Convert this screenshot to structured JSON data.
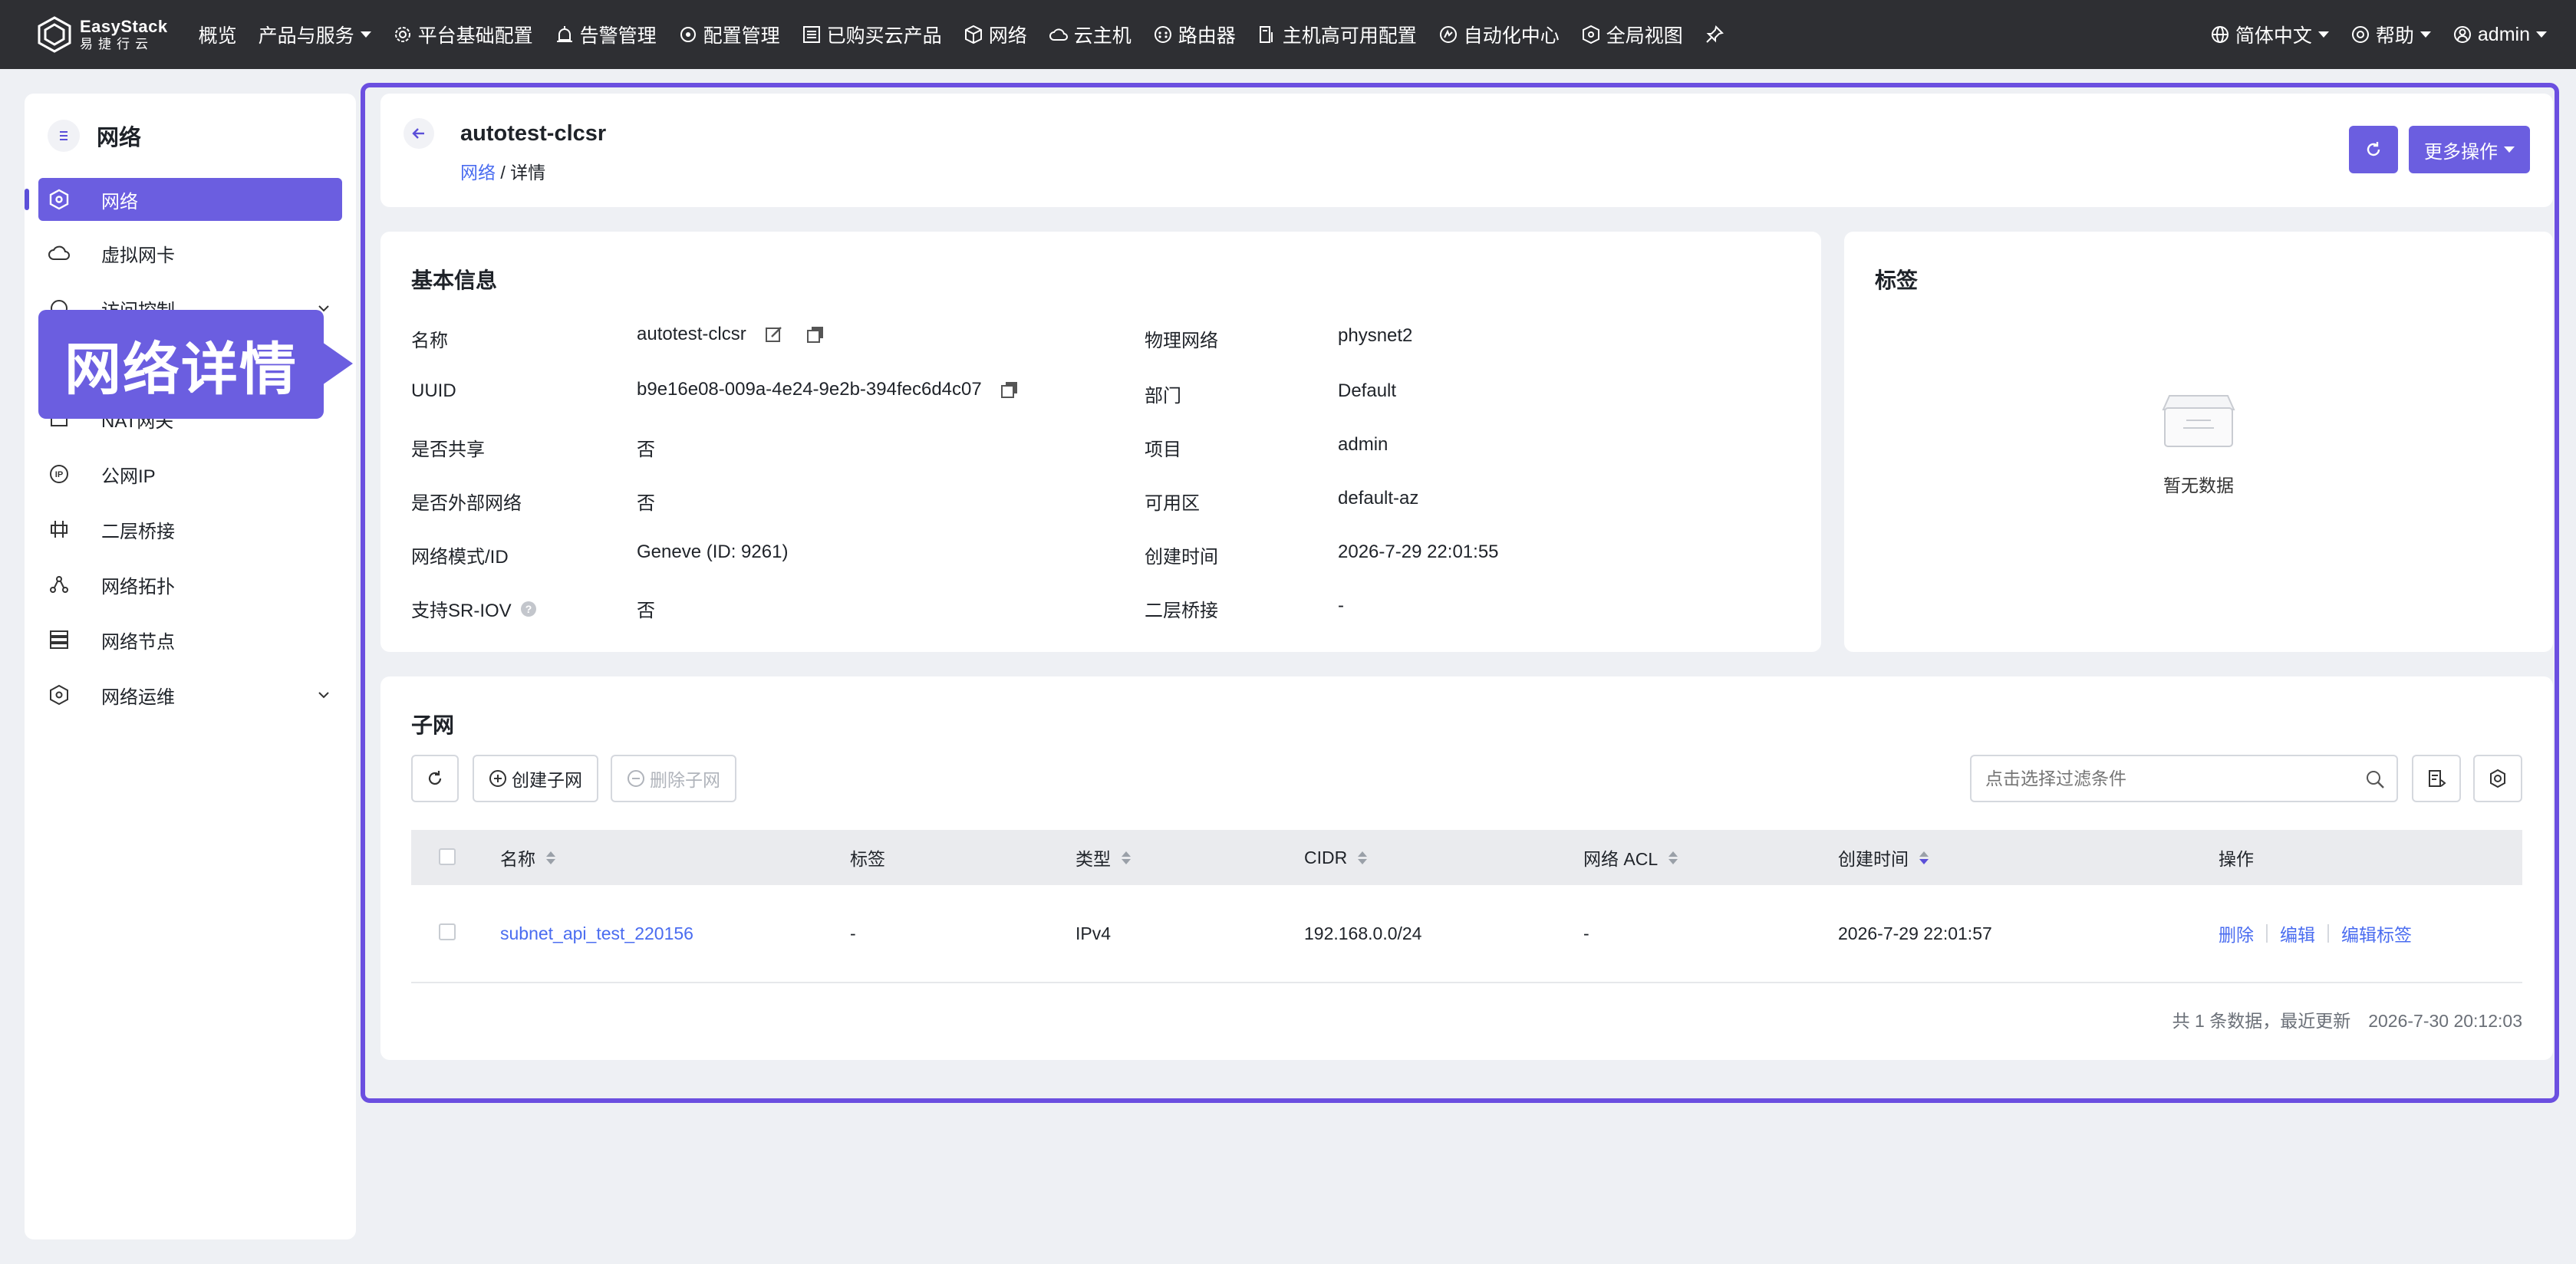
{
  "brand": {
    "en": "EasyStack",
    "cn": "易捷行云"
  },
  "nav": {
    "items": [
      "概览",
      "产品与服务",
      "平台基础配置",
      "告警管理",
      "配置管理",
      "已购买云产品",
      "网络",
      "云主机",
      "路由器",
      "主机高可用配置",
      "自动化中心",
      "全局视图"
    ],
    "language": "简体中文",
    "help": "帮助",
    "user": "admin"
  },
  "sidebar": {
    "title": "网络",
    "items": [
      {
        "label": "网络",
        "active": true
      },
      {
        "label": "虚拟网卡"
      },
      {
        "label": "访问控制"
      },
      {
        "label": "NAT网关"
      },
      {
        "label": "公网IP"
      },
      {
        "label": "二层桥接"
      },
      {
        "label": "网络拓扑"
      },
      {
        "label": "网络节点"
      },
      {
        "label": "网络运维"
      }
    ]
  },
  "callout": {
    "text": "网络详情"
  },
  "header": {
    "title": "autotest-clcsr",
    "breadcrumb_link": "网络",
    "breadcrumb_sep": "/",
    "breadcrumb_current": "详情",
    "more_label": "更多操作"
  },
  "basic": {
    "title": "基本信息",
    "left": [
      {
        "label": "名称",
        "value": "autotest-clcsr"
      },
      {
        "label": "UUID",
        "value": "b9e16e08-009a-4e24-9e2b-394fec6d4c07"
      },
      {
        "label": "是否共享",
        "value": "否"
      },
      {
        "label": "是否外部网络",
        "value": "否"
      },
      {
        "label": "网络模式/ID",
        "value": "Geneve (ID: 9261)"
      },
      {
        "label": "支持SR-IOV",
        "value": "否"
      }
    ],
    "right": [
      {
        "label": "物理网络",
        "value": "physnet2"
      },
      {
        "label": "部门",
        "value": "Default"
      },
      {
        "label": "项目",
        "value": "admin"
      },
      {
        "label": "可用区",
        "value": "default-az"
      },
      {
        "label": "创建时间",
        "value": "2026-7-29 22:01:55"
      },
      {
        "label": "二层桥接",
        "value": "-"
      }
    ]
  },
  "tags": {
    "title": "标签",
    "empty": "暂无数据"
  },
  "subnet": {
    "title": "子网",
    "create_label": "创建子网",
    "delete_label": "删除子网",
    "search_placeholder": "点击选择过滤条件",
    "columns": [
      "名称",
      "标签",
      "类型",
      "CIDR",
      "网络 ACL",
      "创建时间",
      "操作"
    ],
    "rows": [
      {
        "name": "subnet_api_test_220156",
        "tag": "-",
        "type": "IPv4",
        "cidr": "192.168.0.0/24",
        "acl": "-",
        "created": "2026-7-29 22:01:57",
        "actions": [
          "删除",
          "编辑",
          "编辑标签"
        ]
      }
    ],
    "footer": "共 1 条数据，最近更新　2026-7-30 20:12:03"
  },
  "colors": {
    "accent": "#6b5ee0",
    "link": "#4a6cf0",
    "topbar": "#2e2f33"
  }
}
